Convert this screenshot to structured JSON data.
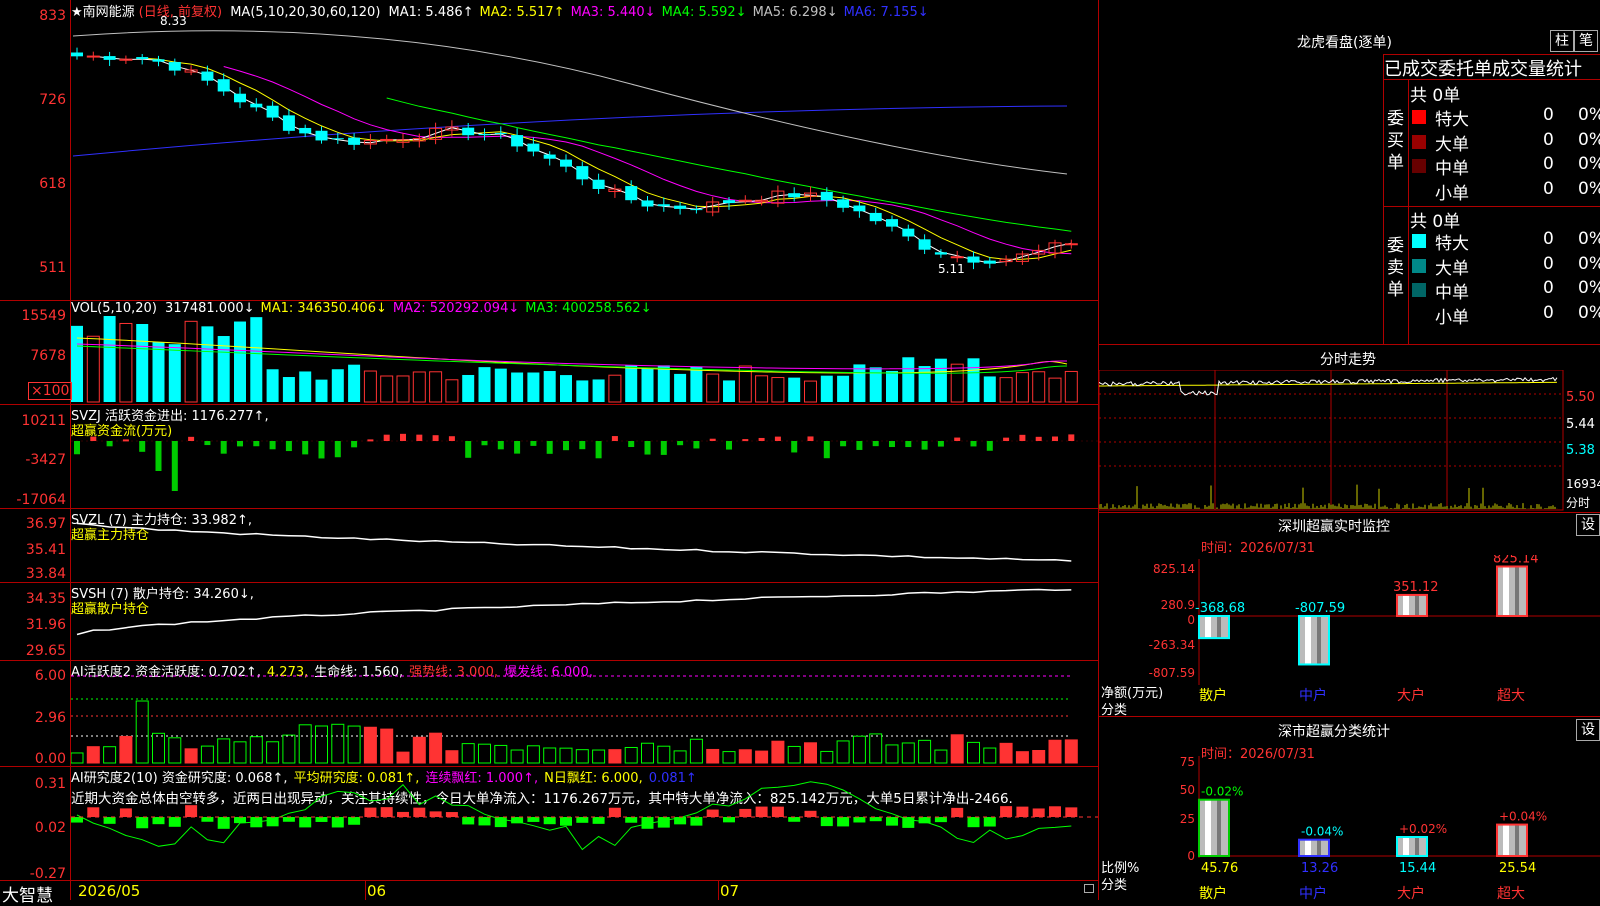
{
  "app_name": "大智慧",
  "main": {
    "title": "★南网能源",
    "period": "(日线, 前复权)",
    "ma_indicator": "MA(5,10,20,30,60,120)",
    "ma_values": [
      {
        "label": "MA1: 5.486↑",
        "color": "#ffffff"
      },
      {
        "label": "MA2: 5.517↑",
        "color": "#ffff00"
      },
      {
        "label": "MA3: 5.440↓",
        "color": "#ff00ff"
      },
      {
        "label": "MA4: 5.592↓",
        "color": "#00ff00"
      },
      {
        "label": "MA5: 6.298↓",
        "color": "#c0c0c0"
      },
      {
        "label": "MA6: 7.155↓",
        "color": "#3030ff"
      }
    ],
    "y_labels": [
      "833",
      "726",
      "618",
      "511"
    ],
    "high_marker": "8.33",
    "low_marker": "5.11"
  },
  "vol": {
    "title": "VOL(5,10,20)",
    "values": [
      {
        "label": "317481.000↓",
        "color": "#ffffff"
      },
      {
        "label": "MA1: 346350.406↓",
        "color": "#ffff00"
      },
      {
        "label": "MA2: 520292.094↓",
        "color": "#ff00ff"
      },
      {
        "label": "MA3: 400258.562↓",
        "color": "#00ff00"
      }
    ],
    "y_labels": [
      "15549",
      "7678",
      "×100"
    ]
  },
  "svzj": {
    "title": "SVZJ  活跃资金进出: 1176.277↑,",
    "subtitle": "超赢资金流(万元)",
    "y_labels": [
      "10211",
      "-3427",
      "-17064"
    ]
  },
  "svzl": {
    "title": "SVZL (7) 主力持仓: 33.982↑,",
    "subtitle": "超赢主力持仓",
    "y_labels": [
      "36.97",
      "35.41",
      "33.84"
    ]
  },
  "svsh": {
    "title": "SVSH (7) 散户持仓: 34.260↓,",
    "subtitle": "超赢散户持仓",
    "y_labels": [
      "34.35",
      "31.96",
      "29.65"
    ]
  },
  "ai1": {
    "values": [
      {
        "label": "AI活跃度2 资金活跃度: 0.702↑,",
        "color": "#ffffff"
      },
      {
        "label": "4.273,",
        "color": "#ffff00"
      },
      {
        "label": "生命线: 1.560,",
        "color": "#ffffff"
      },
      {
        "label": "强势线: 3.000,",
        "color": "#ff3333"
      },
      {
        "label": "爆发线: 6.000,",
        "color": "#ff00ff"
      }
    ],
    "y_labels": [
      "6.00",
      "2.96",
      "0.00"
    ]
  },
  "ai2": {
    "values": [
      {
        "label": "AI研究度2(10) 资金研究度: 0.068↑,",
        "color": "#ffffff"
      },
      {
        "label": "平均研究度: 0.081↑,",
        "color": "#ffff00"
      },
      {
        "label": "连续飘红: 1.000↑,",
        "color": "#ff00ff"
      },
      {
        "label": "N日飘红: 6.000,",
        "color": "#ffff00"
      },
      {
        "label": "0.081↑",
        "color": "#3030ff"
      }
    ],
    "comment": "近期大资金总体由空转多，近两日出现异动，关注其持续性，今日大单净流入：1176.267万元，其中特大单净流入：825.142万元，大单5日累计净出-2466.",
    "y_labels": [
      "0.31",
      "0.02",
      "-0.27"
    ]
  },
  "x_axis": [
    "2026/05",
    "06",
    "07"
  ],
  "lhb": {
    "title": "龙虎看盘(逐单)",
    "btn1": "柱",
    "btn2": "笔",
    "tabs": "已成交委托单成交量统计",
    "buy_side": "委买单",
    "sell_side": "委卖单",
    "buy_total": "共 0单",
    "sell_total": "共 0单",
    "buy_rows": [
      {
        "name": "特大",
        "count": "0",
        "pct": "0%",
        "color": "#ff0000"
      },
      {
        "name": "大单",
        "count": "0",
        "pct": "0%",
        "color": "#990000"
      },
      {
        "name": "中单",
        "count": "0",
        "pct": "0%",
        "color": "#660000"
      },
      {
        "name": "小单",
        "count": "0",
        "pct": "0%",
        "color": ""
      }
    ],
    "sell_rows": [
      {
        "name": "特大",
        "count": "0",
        "pct": "0%",
        "color": "#00ffff"
      },
      {
        "name": "大单",
        "count": "0",
        "pct": "0%",
        "color": "#008888"
      },
      {
        "name": "中单",
        "count": "0",
        "pct": "0%",
        "color": "#006666"
      },
      {
        "name": "小单",
        "count": "0",
        "pct": "0%",
        "color": ""
      }
    ]
  },
  "fenshi": {
    "title": "分时走势",
    "y_labels": [
      "5.50",
      "5.44",
      "5.38"
    ],
    "vol_label": "16934",
    "vol_unit": "分时"
  },
  "monitor": {
    "title": "深圳超赢实时监控",
    "btn": "设",
    "time_label": "时间：",
    "time": "2026/07/31",
    "y_labels": [
      "825.14",
      "280.9",
      "0",
      "-263.34",
      "-807.59"
    ],
    "axis_title_1": "净额(万元)",
    "axis_title_2": "分类",
    "chart_data": {
      "type": "bar",
      "categories": [
        "散户",
        "中户",
        "大户",
        "超大"
      ],
      "values": [
        -368.68,
        -807.59,
        351.12,
        825.14
      ],
      "ylim": [
        -807.59,
        825.14
      ]
    }
  },
  "classify": {
    "title": "深市超赢分类统计",
    "btn": "设",
    "time_label": "时间：",
    "time": "2026/07/31",
    "y_labels": [
      "75",
      "50",
      "25",
      "0"
    ],
    "axis_title_1": "比例%",
    "axis_title_2": "分类",
    "chart_data": {
      "type": "bar",
      "categories": [
        "散户",
        "中户",
        "大户",
        "超大"
      ],
      "values": [
        45.76,
        13.26,
        15.44,
        25.54
      ],
      "changes": [
        "-0.02%",
        "-0.04%",
        "+0.02%",
        "+0.04%"
      ],
      "ylim": [
        0,
        75
      ]
    }
  }
}
